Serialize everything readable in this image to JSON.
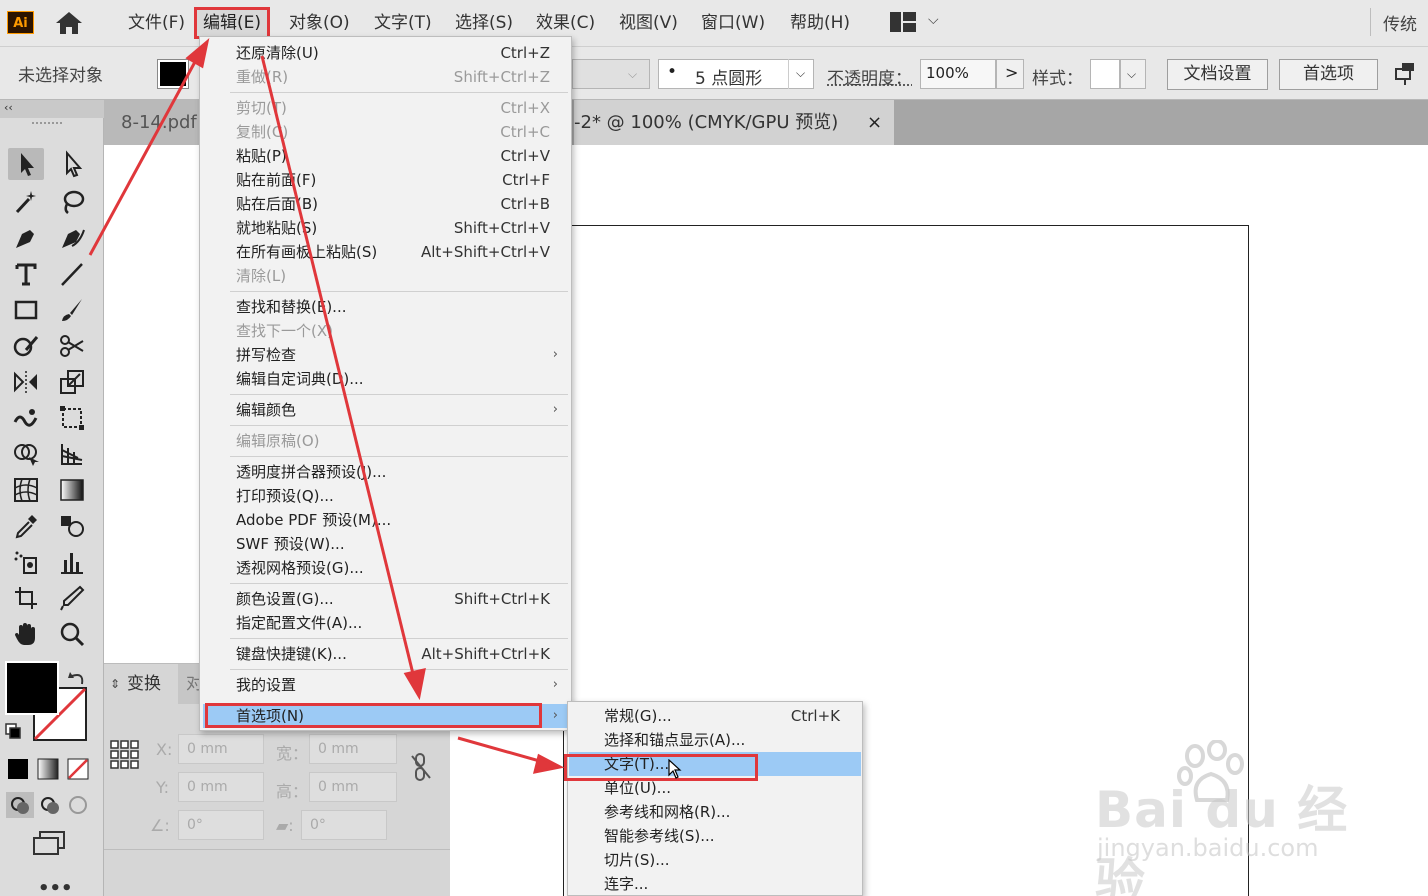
{
  "app": {
    "logo": "Ai"
  },
  "menubar": {
    "items": [
      "文件(F)",
      "编辑(E)",
      "对象(O)",
      "文字(T)",
      "选择(S)",
      "效果(C)",
      "视图(V)",
      "窗口(W)",
      "帮助(H)"
    ],
    "workspace": "传统"
  },
  "controlbar": {
    "selection_status": "未选择对象",
    "brush_dot": "•",
    "brush": "5 点圆形",
    "opacity_label": "不透明度：",
    "opacity_value": "100%",
    "style_label": "样式：",
    "doc_setup": "文档设置",
    "preferences": "首选项"
  },
  "tabs": {
    "tab1": "8-14.pdf",
    "tab2": "-2* @ 100% (CMYK/GPU 预览)",
    "close": "×"
  },
  "edit_menu": {
    "items": [
      {
        "label": "还原清除(U)",
        "shortcut": "Ctrl+Z",
        "disabled": false
      },
      {
        "label": "重做(R)",
        "shortcut": "Shift+Ctrl+Z",
        "disabled": true
      },
      {
        "label": "剪切(T)",
        "shortcut": "Ctrl+X",
        "disabled": true
      },
      {
        "label": "复制(C)",
        "shortcut": "Ctrl+C",
        "disabled": true
      },
      {
        "label": "粘贴(P)",
        "shortcut": "Ctrl+V",
        "disabled": false
      },
      {
        "label": "贴在前面(F)",
        "shortcut": "Ctrl+F",
        "disabled": false
      },
      {
        "label": "贴在后面(B)",
        "shortcut": "Ctrl+B",
        "disabled": false
      },
      {
        "label": "就地粘贴(S)",
        "shortcut": "Shift+Ctrl+V",
        "disabled": false
      },
      {
        "label": "在所有画板上粘贴(S)",
        "shortcut": "Alt+Shift+Ctrl+V",
        "disabled": false
      },
      {
        "label": "清除(L)",
        "shortcut": "",
        "disabled": true
      },
      {
        "label": "查找和替换(E)...",
        "shortcut": "",
        "disabled": false
      },
      {
        "label": "查找下一个(X)",
        "shortcut": "",
        "disabled": true
      },
      {
        "label": "拼写检查",
        "shortcut": "",
        "disabled": false,
        "submenu": true
      },
      {
        "label": "编辑自定词典(D)...",
        "shortcut": "",
        "disabled": false
      },
      {
        "label": "编辑颜色",
        "shortcut": "",
        "disabled": false,
        "submenu": true
      },
      {
        "label": "编辑原稿(O)",
        "shortcut": "",
        "disabled": true
      },
      {
        "label": "透明度拼合器预设(J)...",
        "shortcut": "",
        "disabled": false
      },
      {
        "label": "打印预设(Q)...",
        "shortcut": "",
        "disabled": false
      },
      {
        "label": "Adobe PDF 预设(M)...",
        "shortcut": "",
        "disabled": false
      },
      {
        "label": "SWF 预设(W)...",
        "shortcut": "",
        "disabled": false
      },
      {
        "label": "透视网格预设(G)...",
        "shortcut": "",
        "disabled": false
      },
      {
        "label": "颜色设置(G)...",
        "shortcut": "Shift+Ctrl+K",
        "disabled": false
      },
      {
        "label": "指定配置文件(A)...",
        "shortcut": "",
        "disabled": false
      },
      {
        "label": "键盘快捷键(K)...",
        "shortcut": "Alt+Shift+Ctrl+K",
        "disabled": false
      },
      {
        "label": "我的设置",
        "shortcut": "",
        "disabled": false,
        "submenu": true
      },
      {
        "label": "首选项(N)",
        "shortcut": "",
        "disabled": false,
        "submenu": true,
        "highlighted": true
      }
    ],
    "submenu_arrow": "›"
  },
  "pref_menu": {
    "items": [
      {
        "label": "常规(G)...",
        "shortcut": "Ctrl+K"
      },
      {
        "label": "选择和锚点显示(A)...",
        "shortcut": ""
      },
      {
        "label": "文字(T)...",
        "shortcut": "",
        "highlighted": true
      },
      {
        "label": "单位(U)...",
        "shortcut": ""
      },
      {
        "label": "参考线和网格(R)...",
        "shortcut": ""
      },
      {
        "label": "智能参考线(S)...",
        "shortcut": ""
      },
      {
        "label": "切片(S)...",
        "shortcut": ""
      },
      {
        "label": "连字...",
        "shortcut": ""
      }
    ]
  },
  "transform_panel": {
    "tab": "变换",
    "tab2": "对",
    "x_label": "X:",
    "y_label": "Y:",
    "w_label": "宽：",
    "h_label": "高：",
    "x_value": "0 mm",
    "y_value": "0 mm",
    "w_value": "0 mm",
    "h_value": "0 mm",
    "angle_value": "0°",
    "shear_value": "0°"
  },
  "watermark": {
    "brand": "Bai du 经验",
    "url": "jingyan.baidu.com"
  },
  "colors": {
    "annotation_red": "#e0373b",
    "menu_highlight": "#9ccaf5"
  }
}
